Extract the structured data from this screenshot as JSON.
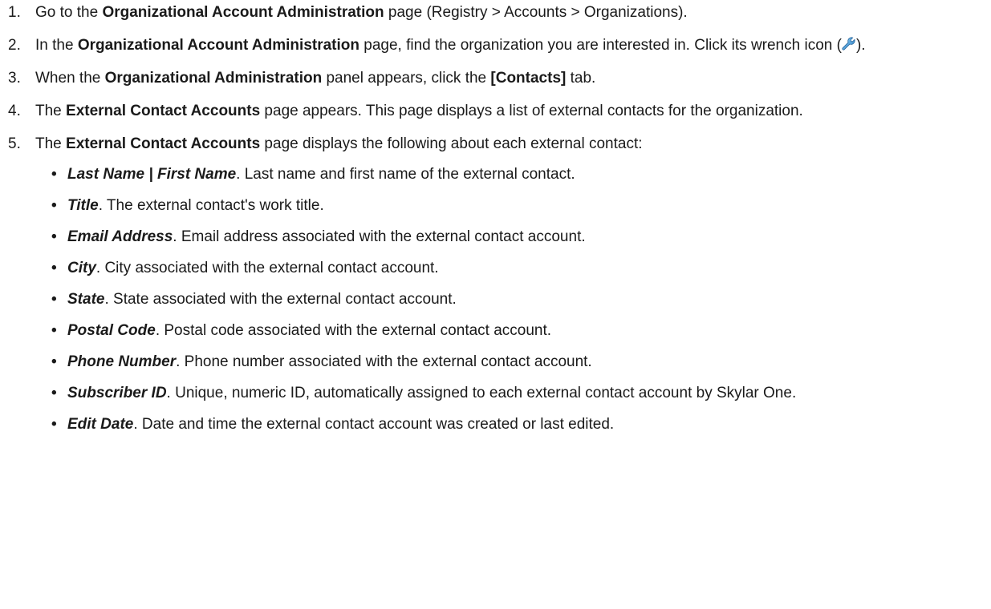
{
  "steps": [
    {
      "num": "1.",
      "t1": "Go to the ",
      "b1": "Organizational Account Administration",
      "t2": " page (Registry > Accounts > Organizations)."
    },
    {
      "num": "2.",
      "t1": "In the ",
      "b1": "Organizational Account Administration",
      "t2": " page, find the organization you are interested in. Click its wrench icon (",
      "t3": ")."
    },
    {
      "num": "3.",
      "t1": "When the ",
      "b1": "Organizational Administration",
      "t2": " panel appears, click the ",
      "b2": "[Contacts]",
      "t3": " tab."
    },
    {
      "num": "4.",
      "t1": "The ",
      "b1": "External Contact Accounts",
      "t2": " page appears. This page displays a list of external contacts for the organization."
    },
    {
      "num": "5.",
      "t1": "The ",
      "b1": "External Contact Accounts",
      "t2": " page displays the following about each external contact:"
    }
  ],
  "fields": [
    {
      "term": "Last Name | First Name",
      "desc": ". Last name and first name of the external contact."
    },
    {
      "term": "Title",
      "desc": ". The external contact's work title."
    },
    {
      "term": "Email Address",
      "desc": ". Email address associated with the external contact account."
    },
    {
      "term": "City",
      "desc": ". City associated with the external contact account."
    },
    {
      "term": "State",
      "desc": ". State associated with the external contact account."
    },
    {
      "term": "Postal Code",
      "desc": ". Postal code associated with the external contact account."
    },
    {
      "term": "Phone Number",
      "desc": ". Phone number associated with the external contact account."
    },
    {
      "term": "Subscriber ID",
      "desc": ". Unique, numeric ID, automatically assigned to each external contact account by Skylar One."
    },
    {
      "term": "Edit Date",
      "desc": ". Date and time the external contact account was created or last edited."
    }
  ],
  "bullet_glyph": "•"
}
